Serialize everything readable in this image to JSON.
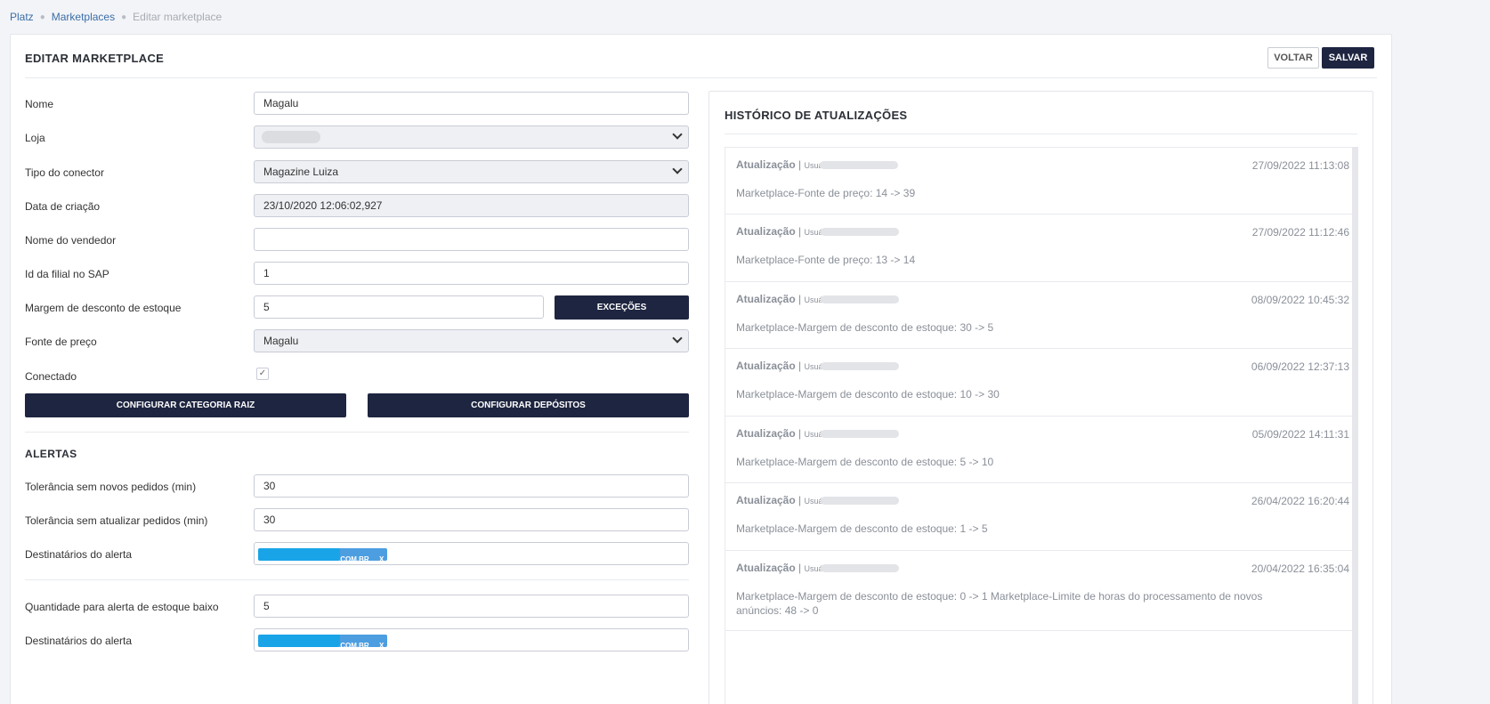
{
  "breadcrumb": {
    "items": [
      "Platz",
      "Marketplaces"
    ],
    "current": "Editar marketplace"
  },
  "header": {
    "title": "EDITAR MARKETPLACE",
    "back_label": "VOLTAR",
    "save_label": "SALVAR"
  },
  "form": {
    "nome": {
      "label": "Nome",
      "value": "Magalu"
    },
    "loja": {
      "label": "Loja",
      "value": ""
    },
    "tipo_conector": {
      "label": "Tipo do conector",
      "value": "Magazine Luiza"
    },
    "data_criacao": {
      "label": "Data de criação",
      "value": "23/10/2020 12:06:02,927"
    },
    "nome_vendedor": {
      "label": "Nome do vendedor",
      "value": ""
    },
    "id_filial": {
      "label": "Id da filial no SAP",
      "value": "1"
    },
    "margem": {
      "label": "Margem de desconto de estoque",
      "value": "5",
      "button": "EXCEÇÕES"
    },
    "fonte_preco": {
      "label": "Fonte de preço",
      "value": "Magalu"
    },
    "conectado": {
      "label": "Conectado",
      "checked": true
    },
    "btn_categoria": "CONFIGURAR CATEGORIA RAIZ",
    "btn_depositos": "CONFIGURAR DEPÓSITOS"
  },
  "alertas": {
    "title": "ALERTAS",
    "tol_novos": {
      "label": "Tolerância sem novos pedidos (min)",
      "value": "30"
    },
    "tol_atualizar": {
      "label": "Tolerância sem atualizar pedidos (min)",
      "value": "30"
    },
    "destinatarios1": {
      "label": "Destinatários do alerta",
      "tag": ".COM.BR",
      "remove": "X"
    },
    "qtd_estoque": {
      "label": "Quantidade para alerta de estoque baixo",
      "value": "5"
    },
    "destinatarios2": {
      "label": "Destinatários do alerta",
      "tag": ".COM.BR",
      "remove": "X"
    }
  },
  "history": {
    "title": "HISTÓRICO DE ATUALIZAÇÕES",
    "entries": [
      {
        "type": "Atualização",
        "user_label": "Usuário:",
        "time": "27/09/2022 11:13:08",
        "text": "Marketplace-Fonte de preço: 14 -> 39"
      },
      {
        "type": "Atualização",
        "user_label": "Usuário:",
        "time": "27/09/2022 11:12:46",
        "text": "Marketplace-Fonte de preço: 13 -> 14"
      },
      {
        "type": "Atualização",
        "user_label": "Usuário:",
        "time": "08/09/2022 10:45:32",
        "text": "Marketplace-Margem de desconto de estoque: 30 -> 5"
      },
      {
        "type": "Atualização",
        "user_label": "Usuário:",
        "time": "06/09/2022 12:37:13",
        "text": "Marketplace-Margem de desconto de estoque: 10 -> 30"
      },
      {
        "type": "Atualização",
        "user_label": "Usuário:",
        "time": "05/09/2022 14:11:31",
        "text": "Marketplace-Margem de desconto de estoque: 5 -> 10"
      },
      {
        "type": "Atualização",
        "user_label": "Usuário:",
        "time": "26/04/2022 16:20:44",
        "text": "Marketplace-Margem de desconto de estoque: 1 -> 5"
      },
      {
        "type": "Atualização",
        "user_label": "Usuário:",
        "time": "20/04/2022 16:35:04",
        "text": "Marketplace-Margem de desconto de estoque: 0 -> 1 Marketplace-Limite de horas do processamento de novos anúncios: 48 -> 0"
      }
    ]
  },
  "icons": {
    "select_arrow": "chevron-down-icon",
    "check": "check-icon",
    "separator": "bullet-separator-icon"
  }
}
